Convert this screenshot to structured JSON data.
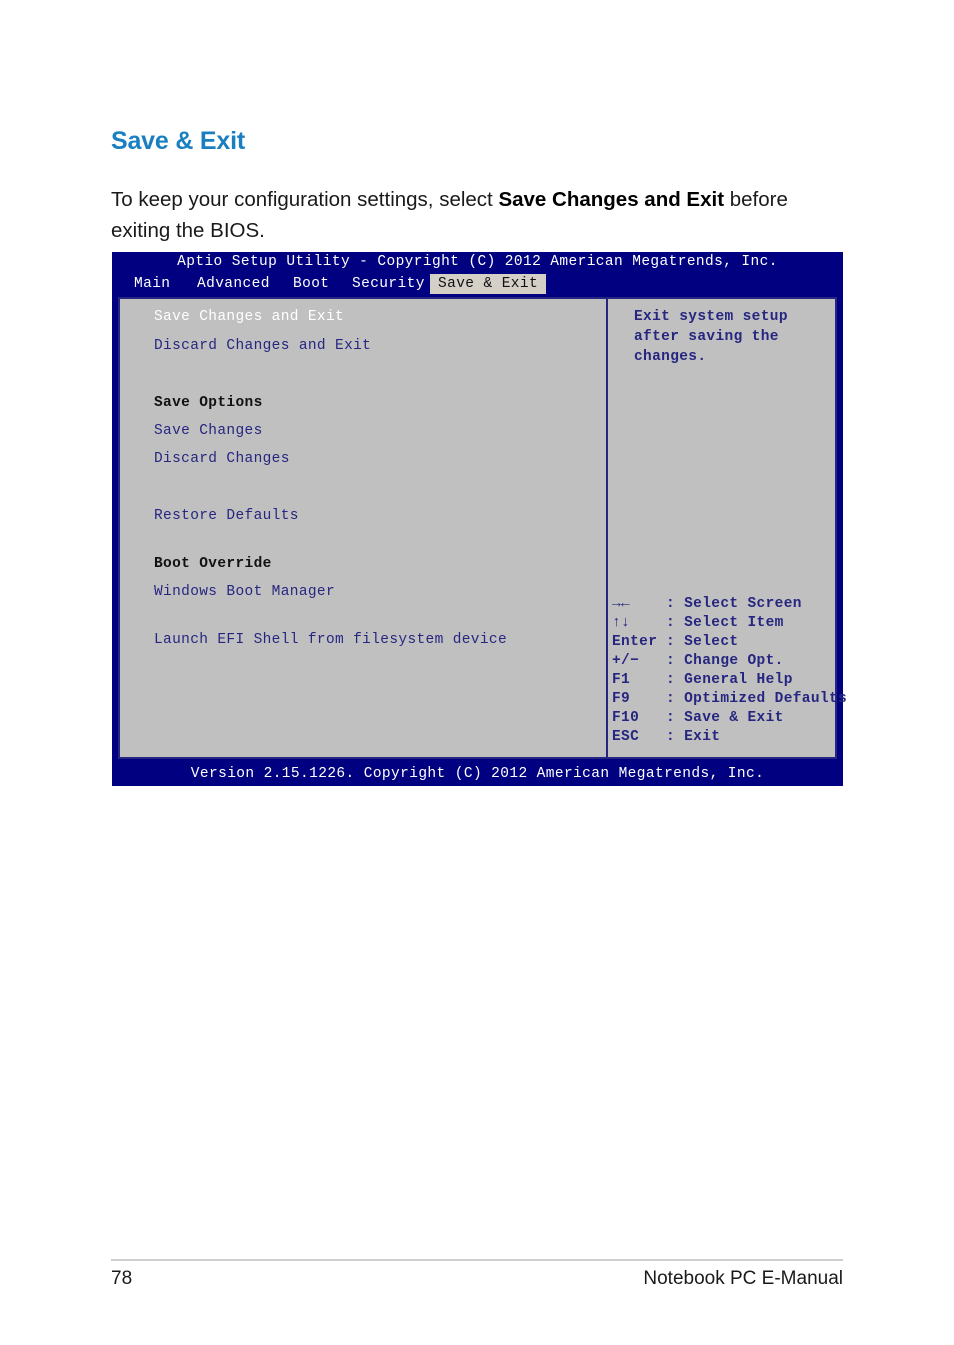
{
  "document": {
    "heading": "Save & Exit",
    "paragraph_part1": "To keep your configuration settings, select ",
    "paragraph_bold": "Save Changes and Exit",
    "paragraph_part2": " before exiting the BIOS."
  },
  "bios": {
    "titlebar": "Aptio Setup Utility - Copyright (C) 2012 American Megatrends, Inc.",
    "menu_tabs": [
      {
        "label": "Main",
        "selected": false
      },
      {
        "label": "Advanced",
        "selected": false
      },
      {
        "label": "Boot",
        "selected": false
      },
      {
        "label": "Security",
        "selected": false
      },
      {
        "label": "Save & Exit",
        "selected": true
      }
    ],
    "left_pane": {
      "items": [
        {
          "label": "Save Changes and Exit",
          "style": "selected"
        },
        {
          "label": "Discard Changes and Exit",
          "style": "normal"
        },
        {
          "label": "Save Options",
          "style": "section"
        },
        {
          "label": "Save Changes",
          "style": "normal"
        },
        {
          "label": "Discard Changes",
          "style": "normal"
        },
        {
          "label": "Restore Defaults",
          "style": "normal"
        },
        {
          "label": "Boot Override",
          "style": "section"
        },
        {
          "label": "Windows Boot Manager",
          "style": "normal"
        },
        {
          "label": "Launch EFI Shell from filesystem device",
          "style": "normal"
        }
      ]
    },
    "right_pane": {
      "help_lines": [
        "Exit system setup",
        "after saving the",
        "changes."
      ],
      "key_legend": [
        {
          "key": "→←",
          "sep": ":",
          "action": "Select Screen"
        },
        {
          "key": "↑↓",
          "sep": ":",
          "action": "Select Item"
        },
        {
          "key": "Enter",
          "sep": ":",
          "action": "Select"
        },
        {
          "key": "+/−",
          "sep": ":",
          "action": "Change Opt."
        },
        {
          "key": "F1",
          "sep": ":",
          "action": "General Help"
        },
        {
          "key": "F9",
          "sep": ":",
          "action": "Optimized Defaults"
        },
        {
          "key": "F10",
          "sep": ":",
          "action": "Save & Exit"
        },
        {
          "key": "ESC",
          "sep": ":",
          "action": "Exit"
        }
      ]
    },
    "footer": "Version 2.15.1226. Copyright (C) 2012 American Megatrends, Inc."
  },
  "page_footer": {
    "page_number": "78",
    "doc_title": "Notebook PC E-Manual"
  },
  "colors": {
    "heading_blue": "#1a7fc1",
    "bios_navy": "#000080",
    "bios_panel_gray": "#c0c0c0",
    "bios_text_blue": "#262680",
    "bios_tab_selected_bg": "#d4d0c8"
  }
}
